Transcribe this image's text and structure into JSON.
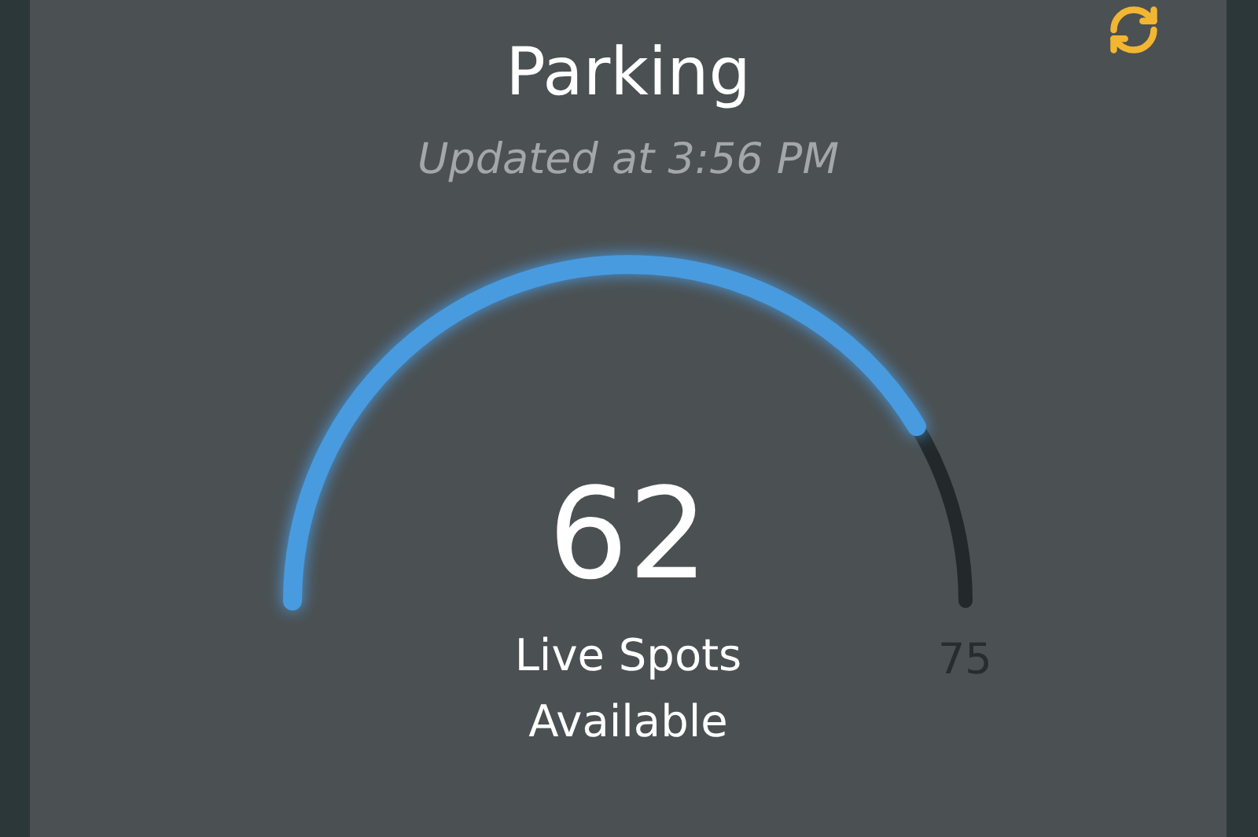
{
  "title": "Parking",
  "updated": "Updated at 3:56 PM",
  "gauge": {
    "value": "62",
    "caption": "Live Spots Available",
    "max": "75"
  }
}
